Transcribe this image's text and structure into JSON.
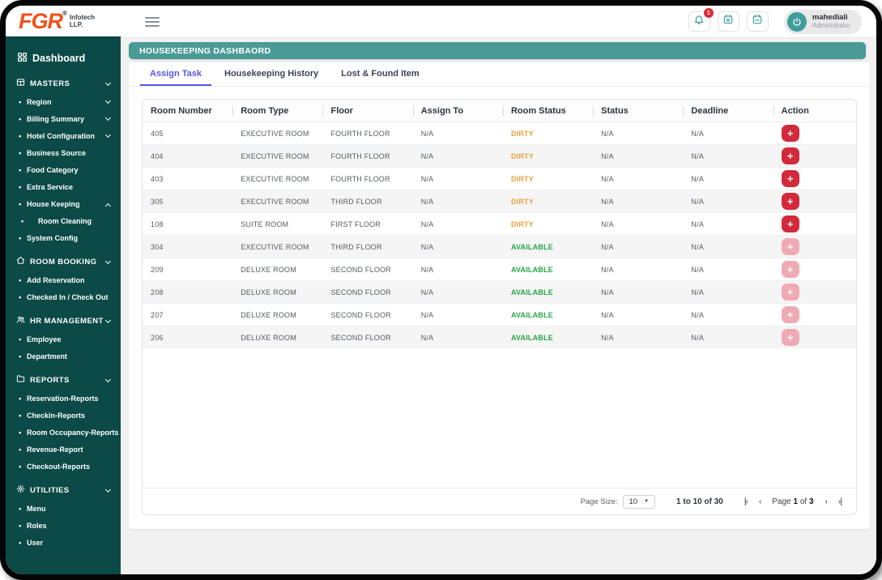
{
  "brand": {
    "logo_text": "FGR",
    "registered_mark": "®",
    "company_line1": "Infotech",
    "company_line2": "LLP."
  },
  "topbar": {
    "notification_badge": "1",
    "user_name": "mahediali",
    "user_role": "Administrator"
  },
  "sidebar": {
    "dashboard_label": "Dashboard",
    "groups": [
      {
        "label": "MASTERS",
        "items": [
          {
            "label": "Region"
          },
          {
            "label": "Billing Summary"
          },
          {
            "label": "Hotel Configuration"
          },
          {
            "label": "Business Source"
          },
          {
            "label": "Food Category"
          },
          {
            "label": "Extra Service"
          },
          {
            "label": "House Keeping"
          },
          {
            "label": "Room Cleaning"
          },
          {
            "label": "System Config"
          }
        ]
      },
      {
        "label": "ROOM BOOKING",
        "items": [
          {
            "label": "Add Reservation"
          },
          {
            "label": "Checked In / Check Out"
          }
        ]
      },
      {
        "label": "HR MANAGEMENT",
        "items": [
          {
            "label": "Employee"
          },
          {
            "label": "Department"
          }
        ]
      },
      {
        "label": "REPORTS",
        "items": [
          {
            "label": "Reservation-Reports"
          },
          {
            "label": "Checkin-Reports"
          },
          {
            "label": "Room Occupancy-Reports"
          },
          {
            "label": "Revenue-Report"
          },
          {
            "label": "Checkout-Reports"
          }
        ]
      },
      {
        "label": "UTILITIES",
        "items": [
          {
            "label": "Menu"
          },
          {
            "label": "Roles"
          },
          {
            "label": "User"
          }
        ]
      }
    ]
  },
  "main": {
    "banner_title": "HOUSEKEEPING DASHBAORD",
    "tabs": [
      {
        "label": "Assign Task"
      },
      {
        "label": "Housekeeping History"
      },
      {
        "label": "Lost & Found Item"
      }
    ],
    "table": {
      "columns": [
        "Room Number",
        "Room Type",
        "Floor",
        "Assign To",
        "Room Status",
        "Status",
        "Deadline",
        "Action"
      ],
      "rows": [
        {
          "room_number": "405",
          "room_type": "EXECUTIVE ROOM",
          "floor": "FOURTH FLOOR",
          "assign_to": "N/A",
          "room_status": "DIRTY",
          "status": "N/A",
          "deadline": "N/A",
          "action": "+"
        },
        {
          "room_number": "404",
          "room_type": "EXECUTIVE ROOM",
          "floor": "FOURTH FLOOR",
          "assign_to": "N/A",
          "room_status": "DIRTY",
          "status": "N/A",
          "deadline": "N/A",
          "action": "+"
        },
        {
          "room_number": "403",
          "room_type": "EXECUTIVE ROOM",
          "floor": "FOURTH FLOOR",
          "assign_to": "N/A",
          "room_status": "DIRTY",
          "status": "N/A",
          "deadline": "N/A",
          "action": "+"
        },
        {
          "room_number": "305",
          "room_type": "EXECUTIVE ROOM",
          "floor": "THIRD FLOOR",
          "assign_to": "N/A",
          "room_status": "DIRTY",
          "status": "N/A",
          "deadline": "N/A",
          "action": "+"
        },
        {
          "room_number": "108",
          "room_type": "SUITE ROOM",
          "floor": "FIRST FLOOR",
          "assign_to": "N/A",
          "room_status": "DIRTY",
          "status": "N/A",
          "deadline": "N/A",
          "action": "+"
        },
        {
          "room_number": "304",
          "room_type": "EXECUTIVE ROOM",
          "floor": "THIRD FLOOR",
          "assign_to": "N/A",
          "room_status": "AVAILABLE",
          "status": "N/A",
          "deadline": "N/A",
          "action": "+"
        },
        {
          "room_number": "209",
          "room_type": "DELUXE ROOM",
          "floor": "SECOND FLOOR",
          "assign_to": "N/A",
          "room_status": "AVAILABLE",
          "status": "N/A",
          "deadline": "N/A",
          "action": "+"
        },
        {
          "room_number": "208",
          "room_type": "DELUXE ROOM",
          "floor": "SECOND FLOOR",
          "assign_to": "N/A",
          "room_status": "AVAILABLE",
          "status": "N/A",
          "deadline": "N/A",
          "action": "+"
        },
        {
          "room_number": "207",
          "room_type": "DELUXE ROOM",
          "floor": "SECOND FLOOR",
          "assign_to": "N/A",
          "room_status": "AVAILABLE",
          "status": "N/A",
          "deadline": "N/A",
          "action": "+"
        },
        {
          "room_number": "206",
          "room_type": "DELUXE ROOM",
          "floor": "SECOND FLOOR",
          "assign_to": "N/A",
          "room_status": "AVAILABLE",
          "status": "N/A",
          "deadline": "N/A",
          "action": "+"
        }
      ]
    },
    "pagination": {
      "page_size_label": "Page Size:",
      "page_size_value": "10",
      "range_text": "1 to 10 of 30",
      "page_prefix": "Page",
      "current_page": "1",
      "of_text": "of",
      "total_pages": "3"
    }
  },
  "icons": {
    "select_arrow": "▼",
    "first_page": "|‹",
    "prev_page": "‹",
    "next_page": "›",
    "last_page": "›|"
  },
  "colors": {
    "sidebar_bg": "#0b4a46",
    "banner_bg": "#4a9b97",
    "active_tab": "#5a55ea",
    "status_dirty": "#e8a33d",
    "status_available": "#28a745",
    "action_red": "#d2293b",
    "action_red_disabled": "#efaab3",
    "logo_orange": "#f1511b",
    "badge_red": "#e02b38"
  }
}
